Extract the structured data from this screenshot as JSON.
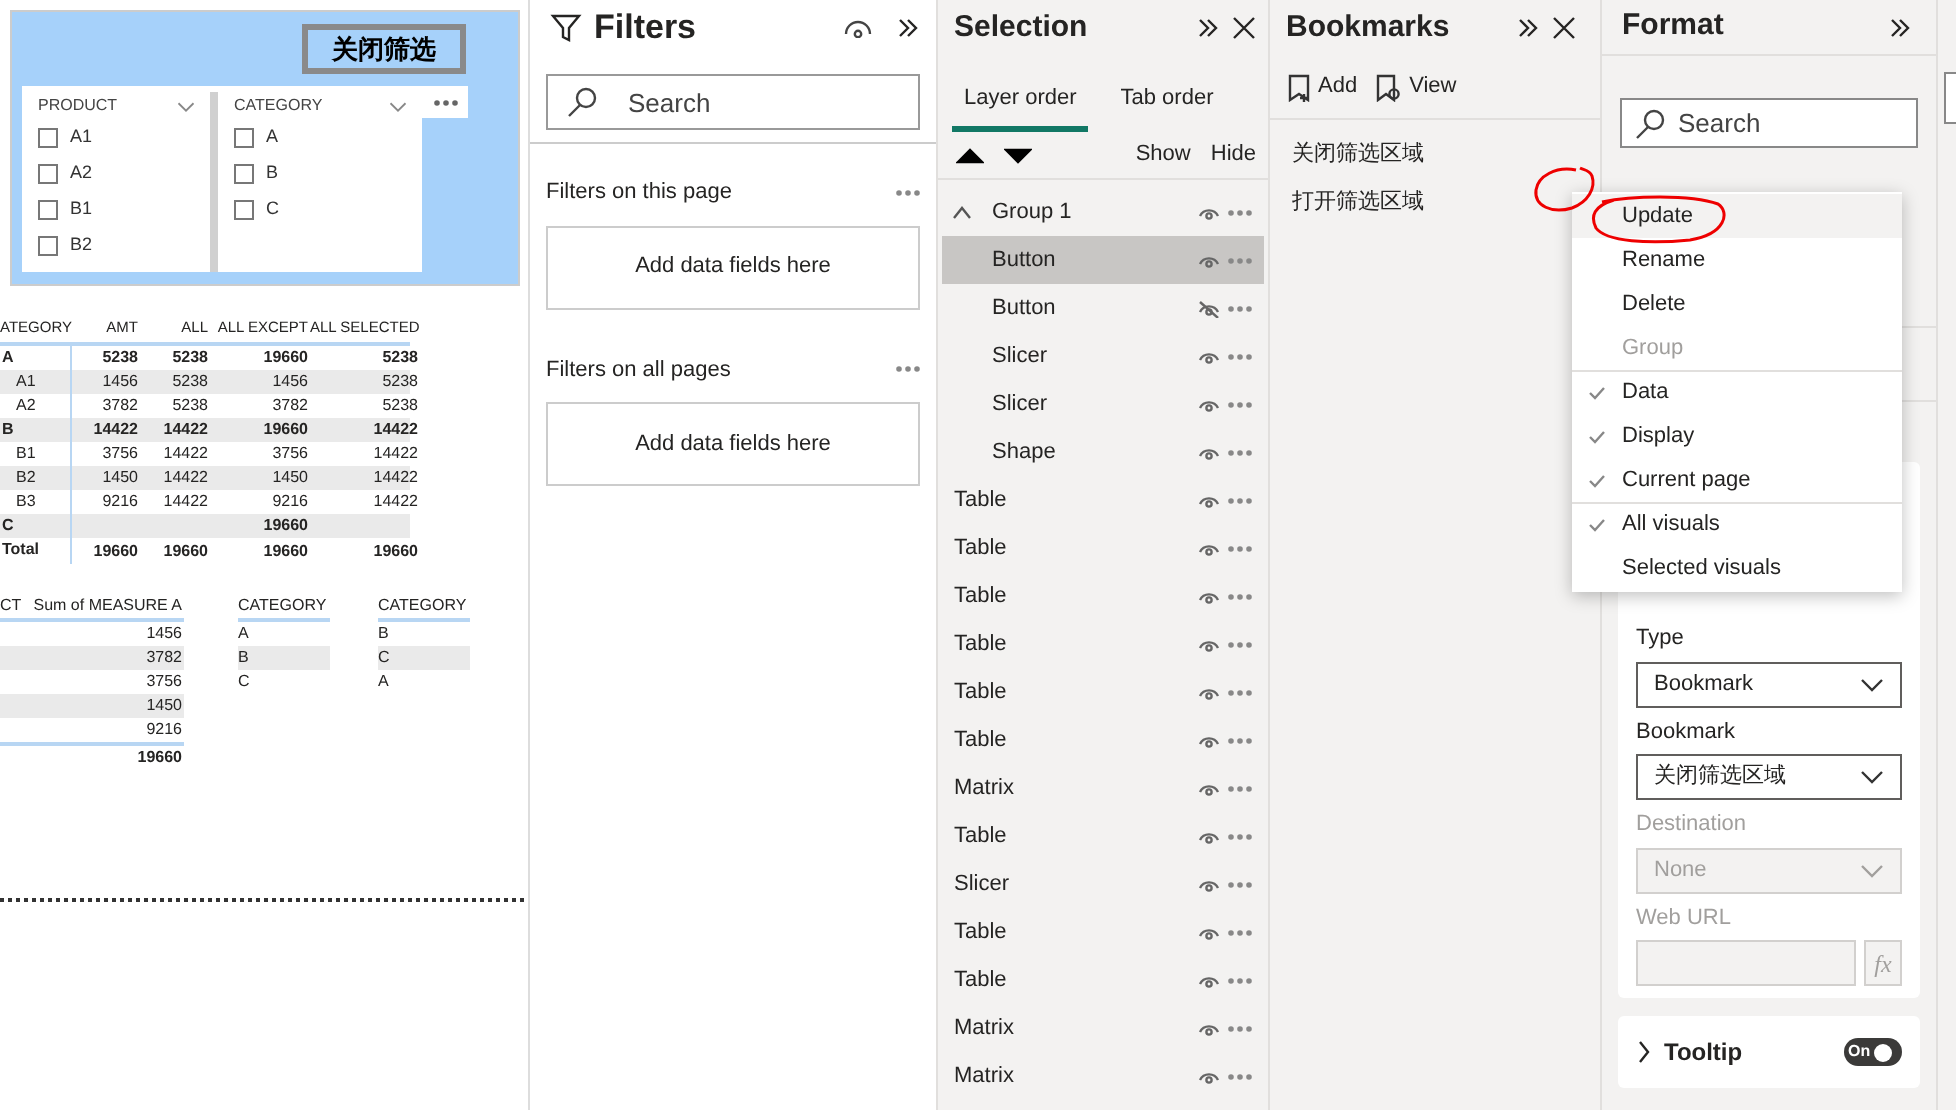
{
  "canvas": {
    "button": {
      "label": "关闭筛选"
    },
    "slicers": [
      {
        "title": "PRODUCT",
        "items": [
          {
            "label": "A1",
            "checked": false
          },
          {
            "label": "A2",
            "checked": false
          },
          {
            "label": "B1",
            "checked": false
          },
          {
            "label": "B2",
            "checked": false
          }
        ]
      },
      {
        "title": "CATEGORY",
        "items": [
          {
            "label": "A",
            "checked": false
          },
          {
            "label": "B",
            "checked": false
          },
          {
            "label": "C",
            "checked": false
          }
        ]
      }
    ],
    "matrix": {
      "columns": [
        "ATEGORY",
        "AMT",
        "ALL",
        "ALL EXCEPT",
        "ALL SELECTED"
      ],
      "rows": [
        {
          "label": "A",
          "amt": "5238",
          "all": "5238",
          "all_except": "19660",
          "all_selected": "5238",
          "children": [
            {
              "label": "A1",
              "amt": "1456",
              "all": "5238",
              "all_except": "1456",
              "all_selected": "5238"
            },
            {
              "label": "A2",
              "amt": "3782",
              "all": "5238",
              "all_except": "3782",
              "all_selected": "5238"
            }
          ]
        },
        {
          "label": "B",
          "amt": "14422",
          "all": "14422",
          "all_except": "19660",
          "all_selected": "14422",
          "children": [
            {
              "label": "B1",
              "amt": "3756",
              "all": "14422",
              "all_except": "3756",
              "all_selected": "14422"
            },
            {
              "label": "B2",
              "amt": "1450",
              "all": "14422",
              "all_except": "1450",
              "all_selected": "14422"
            },
            {
              "label": "B3",
              "amt": "9216",
              "all": "14422",
              "all_except": "9216",
              "all_selected": "14422"
            }
          ]
        },
        {
          "label": "C",
          "all_except": "19660"
        }
      ],
      "total": {
        "label": "Total",
        "amt": "19660",
        "all": "19660",
        "all_except": "19660",
        "all_selected": "19660"
      }
    },
    "measure_table": {
      "columns": [
        "CT",
        "Sum of MEASURE A"
      ],
      "rows": [
        "1456",
        "3782",
        "3756",
        "1450",
        "9216"
      ],
      "total": "19660"
    },
    "category_tables": [
      {
        "column": "CATEGORY",
        "rows": [
          "A",
          "B",
          "C"
        ]
      },
      {
        "column": "CATEGORY",
        "rows": [
          "B",
          "C",
          "A"
        ]
      }
    ]
  },
  "filters": {
    "title": "Filters",
    "search": {
      "placeholder": "Search"
    },
    "sections": [
      {
        "title": "Filters on this page",
        "drop": "Add data fields here"
      },
      {
        "title": "Filters on all pages",
        "drop": "Add data fields here"
      }
    ]
  },
  "selection": {
    "title": "Selection",
    "tabs": [
      {
        "label": "Layer order",
        "selected": true
      },
      {
        "label": "Tab order",
        "selected": false
      }
    ],
    "show": "Show",
    "hide": "Hide",
    "items": [
      {
        "name": "Group 1",
        "visible": true,
        "selected": false,
        "expanded": true,
        "children": [
          {
            "name": "Button",
            "visible": true,
            "selected": true
          },
          {
            "name": "Button",
            "visible": false,
            "selected": false
          },
          {
            "name": "Slicer",
            "visible": true,
            "selected": false
          },
          {
            "name": "Slicer",
            "visible": true,
            "selected": false
          },
          {
            "name": "Shape",
            "visible": true,
            "selected": false
          }
        ]
      },
      {
        "name": "Table",
        "visible": true,
        "selected": false
      },
      {
        "name": "Table",
        "visible": true,
        "selected": false
      },
      {
        "name": "Table",
        "visible": true,
        "selected": false
      },
      {
        "name": "Table",
        "visible": true,
        "selected": false
      },
      {
        "name": "Table",
        "visible": true,
        "selected": false
      },
      {
        "name": "Table",
        "visible": true,
        "selected": false
      },
      {
        "name": "Matrix",
        "visible": true,
        "selected": false
      },
      {
        "name": "Table",
        "visible": true,
        "selected": false
      },
      {
        "name": "Slicer",
        "visible": true,
        "selected": false
      },
      {
        "name": "Table",
        "visible": true,
        "selected": false
      },
      {
        "name": "Table",
        "visible": true,
        "selected": false
      },
      {
        "name": "Matrix",
        "visible": true,
        "selected": false
      },
      {
        "name": "Matrix",
        "visible": true,
        "selected": false
      }
    ]
  },
  "bookmarks": {
    "title": "Bookmarks",
    "add": "Add",
    "view": "View",
    "items": [
      "关闭筛选区域",
      "打开筛选区域"
    ]
  },
  "context_menu": {
    "items": [
      {
        "label": "Update",
        "selected": true,
        "disabled": false,
        "checked": false,
        "separator_before": false
      },
      {
        "label": "Rename",
        "selected": false,
        "disabled": false,
        "checked": false,
        "separator_before": false
      },
      {
        "label": "Delete",
        "selected": false,
        "disabled": false,
        "checked": false,
        "separator_before": false
      },
      {
        "label": "Group",
        "selected": false,
        "disabled": true,
        "checked": false,
        "separator_before": false
      },
      {
        "label": "Data",
        "selected": false,
        "disabled": false,
        "checked": true,
        "separator_before": true
      },
      {
        "label": "Display",
        "selected": false,
        "disabled": false,
        "checked": true,
        "separator_before": false
      },
      {
        "label": "Current page",
        "selected": false,
        "disabled": false,
        "checked": true,
        "separator_before": false
      },
      {
        "label": "All visuals",
        "selected": false,
        "disabled": false,
        "checked": true,
        "separator_before": true
      },
      {
        "label": "Selected visuals",
        "selected": false,
        "disabled": false,
        "checked": false,
        "separator_before": false
      }
    ]
  },
  "format": {
    "title": "Format",
    "search": {
      "placeholder": "Search"
    },
    "fields": [
      {
        "kind": "select",
        "label": "Type",
        "value": "Bookmark",
        "disabled": false
      },
      {
        "kind": "select",
        "label": "Bookmark",
        "value": "关闭筛选区域",
        "disabled": false
      },
      {
        "kind": "select",
        "label": "Destination",
        "value": "None",
        "disabled": true
      },
      {
        "kind": "input",
        "label": "Web URL",
        "disabled": true,
        "fx": "fx"
      }
    ],
    "tooltip": {
      "label": "Tooltip",
      "expanded": false,
      "toggle": {
        "text": "On",
        "on": true
      }
    }
  }
}
